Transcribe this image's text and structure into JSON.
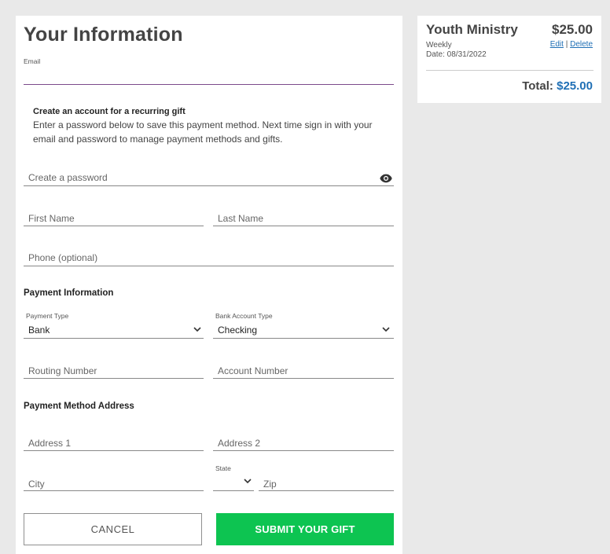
{
  "form": {
    "title": "Your Information",
    "email": {
      "label": "Email",
      "value": ""
    },
    "account": {
      "heading": "Create an account for a recurring gift",
      "description_line1": "Enter a password below to save this payment method. Next time sign in with your",
      "description_line2": "email and password to manage payment methods and gifts."
    },
    "password": {
      "placeholder": "Create a password",
      "toggle_icon": "eye-icon"
    },
    "first_name": {
      "placeholder": "First Name"
    },
    "last_name": {
      "placeholder": "Last Name"
    },
    "phone": {
      "placeholder": "Phone (optional)"
    },
    "payment": {
      "heading": "Payment Information",
      "payment_type": {
        "label": "Payment Type",
        "value": "Bank"
      },
      "bank_account_type": {
        "label": "Bank Account Type",
        "value": "Checking"
      },
      "routing_number": {
        "placeholder": "Routing Number"
      },
      "account_number": {
        "placeholder": "Account Number"
      }
    },
    "address": {
      "heading": "Payment Method Address",
      "address1": {
        "placeholder": "Address 1"
      },
      "address2": {
        "placeholder": "Address 2"
      },
      "city": {
        "placeholder": "City"
      },
      "state": {
        "label": "State",
        "value": ""
      },
      "zip": {
        "placeholder": "Zip"
      }
    },
    "buttons": {
      "cancel": "CANCEL",
      "submit": "SUBMIT YOUR GIFT"
    }
  },
  "summary": {
    "fund": "Youth Ministry",
    "amount": "$25.00",
    "frequency": "Weekly",
    "date": "Date: 08/31/2022",
    "edit": "Edit",
    "separator": "|",
    "delete": "Delete",
    "total_label": "Total:",
    "total_amount": "$25.00"
  },
  "colors": {
    "background": "#e9e9e9",
    "submit_button": "#0dc451",
    "link": "#1f6fb5",
    "focus_underline": "#7b4a8a"
  }
}
